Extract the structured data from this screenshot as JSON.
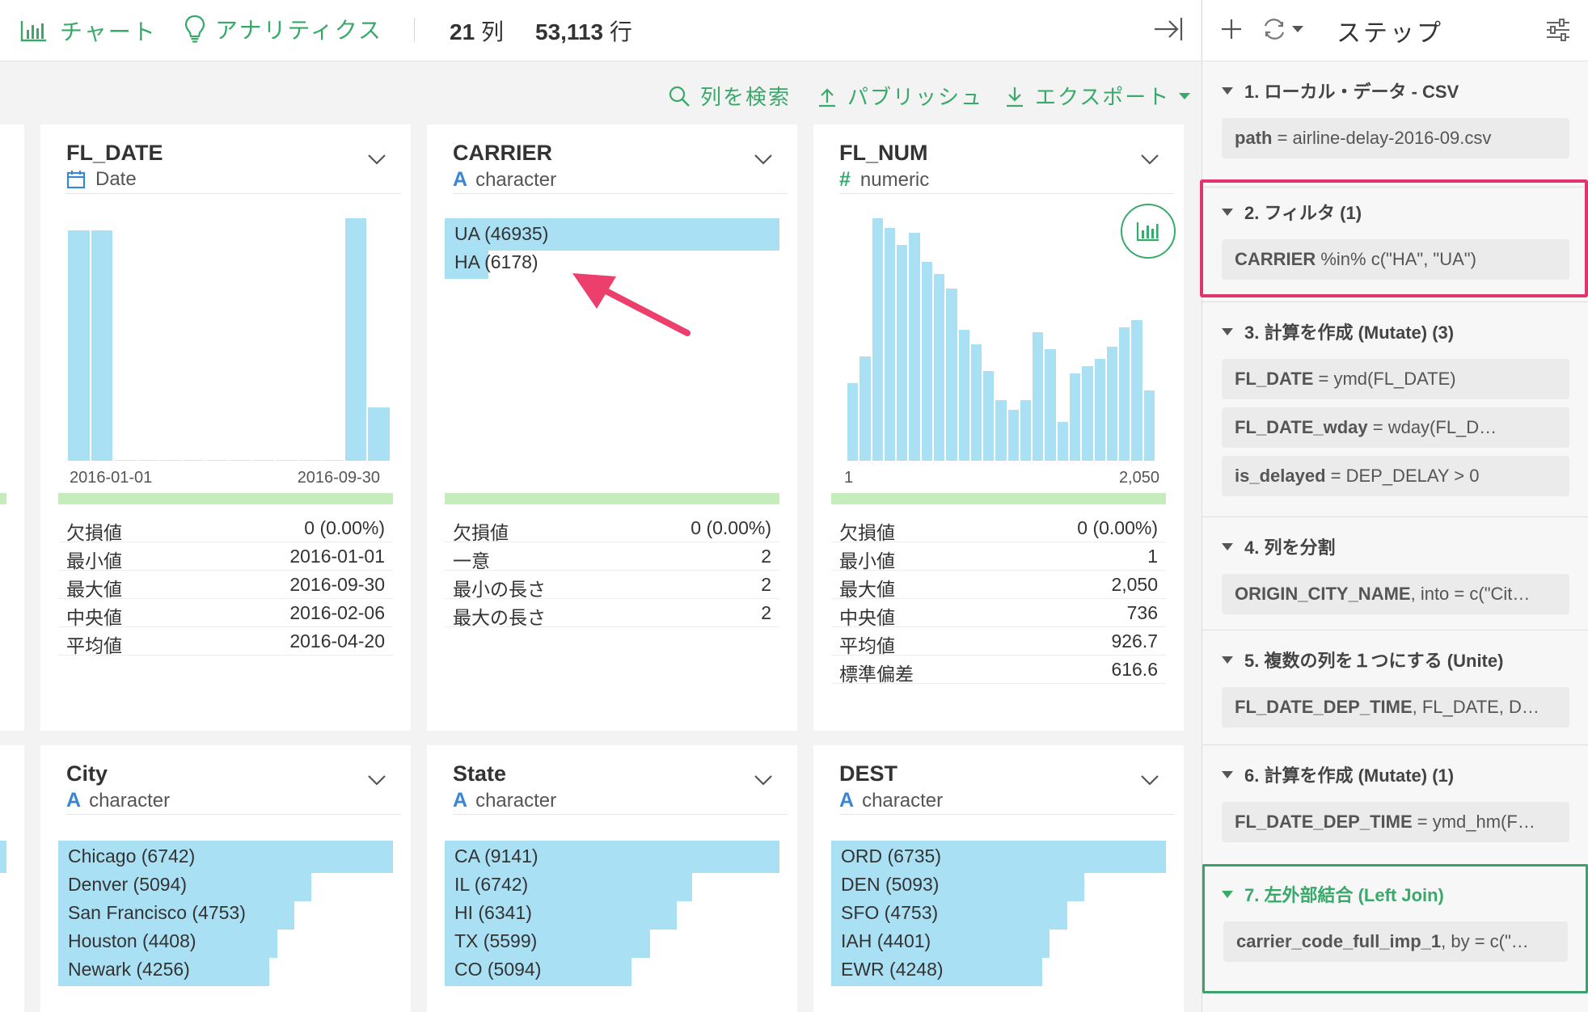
{
  "toolbar": {
    "chart_label": "チャート",
    "analytics_label": "アナリティクス",
    "cols_count": "21",
    "cols_unit": "列",
    "rows_count": "53,113",
    "rows_unit": "行"
  },
  "subbar": {
    "search_label": "列を検索",
    "publish_label": "パブリッシュ",
    "export_label": "エクスポート"
  },
  "cards": {
    "fl_date": {
      "name": "FL_DATE",
      "type": "Date",
      "axis_min": "2016-01-01",
      "axis_max": "2016-09-30",
      "hist": [
        0.95,
        0.95,
        0,
        0,
        0,
        0,
        0,
        0,
        0,
        0,
        0,
        0,
        1.0,
        0.22
      ],
      "stats": [
        {
          "k": "欠損値",
          "v": "0 (0.00%)"
        },
        {
          "k": "最小値",
          "v": "2016-01-01"
        },
        {
          "k": "最大値",
          "v": "2016-09-30"
        },
        {
          "k": "中央値",
          "v": "2016-02-06"
        },
        {
          "k": "平均値",
          "v": "2016-04-20"
        }
      ]
    },
    "carrier": {
      "name": "CARRIER",
      "type": "character",
      "cats": [
        {
          "label": "UA (46935)",
          "frac": 1.0
        },
        {
          "label": "HA (6178)",
          "frac": 0.13
        }
      ],
      "stats": [
        {
          "k": "欠損値",
          "v": "0 (0.00%)"
        },
        {
          "k": "一意",
          "v": "2"
        },
        {
          "k": "最小の長さ",
          "v": "2"
        },
        {
          "k": "最大の長さ",
          "v": "2"
        }
      ]
    },
    "fl_num": {
      "name": "FL_NUM",
      "type": "numeric",
      "axis_min": "1",
      "axis_max": "2,050",
      "hist": [
        0.32,
        0.43,
        1.0,
        0.96,
        0.89,
        0.94,
        0.82,
        0.77,
        0.71,
        0.54,
        0.48,
        0.37,
        0.25,
        0.21,
        0.25,
        0.53,
        0.46,
        0.16,
        0.36,
        0.39,
        0.42,
        0.47,
        0.55,
        0.58,
        0.29
      ],
      "stats": [
        {
          "k": "欠損値",
          "v": "0 (0.00%)"
        },
        {
          "k": "最小値",
          "v": "1"
        },
        {
          "k": "最大値",
          "v": "2,050"
        },
        {
          "k": "中央値",
          "v": "736"
        },
        {
          "k": "平均値",
          "v": "926.7"
        },
        {
          "k": "標準偏差",
          "v": "616.6"
        }
      ]
    },
    "city": {
      "name": "City",
      "type": "character",
      "cats": [
        {
          "label": "Chicago (6742)",
          "frac": 1.0
        },
        {
          "label": "Denver (5094)",
          "frac": 0.755
        },
        {
          "label": "San Francisco (4753)",
          "frac": 0.705
        },
        {
          "label": "Houston (4408)",
          "frac": 0.654
        },
        {
          "label": "Newark (4256)",
          "frac": 0.631
        }
      ]
    },
    "state": {
      "name": "State",
      "type": "character",
      "cats": [
        {
          "label": "CA (9141)",
          "frac": 1.0
        },
        {
          "label": "IL (6742)",
          "frac": 0.738
        },
        {
          "label": "HI (6341)",
          "frac": 0.694
        },
        {
          "label": "TX (5599)",
          "frac": 0.613
        },
        {
          "label": "CO (5094)",
          "frac": 0.557
        }
      ]
    },
    "dest": {
      "name": "DEST",
      "type": "character",
      "cats": [
        {
          "label": "ORD (6735)",
          "frac": 1.0
        },
        {
          "label": "DEN (5093)",
          "frac": 0.756
        },
        {
          "label": "SFO (4753)",
          "frac": 0.706
        },
        {
          "label": "IAH (4401)",
          "frac": 0.653
        },
        {
          "label": "EWR (4248)",
          "frac": 0.631
        }
      ]
    }
  },
  "steps_panel": {
    "title": "ステップ",
    "steps": [
      {
        "title": "1. ローカル・データ - CSV",
        "chips": [
          {
            "bold": "path",
            "rest": " = airline-delay-2016-09.csv"
          }
        ]
      },
      {
        "title": "2. フィルタ (1)",
        "chips": [
          {
            "bold": "CARRIER",
            "rest": " %in% c(\"HA\", \"UA\")"
          }
        ]
      },
      {
        "title": "3. 計算を作成 (Mutate) (3)",
        "chips": [
          {
            "bold": "FL_DATE",
            "rest": " = ymd(FL_DATE)"
          },
          {
            "bold": "FL_DATE_wday",
            "rest": " = wday(FL_D…"
          },
          {
            "bold": "is_delayed",
            "rest": " = DEP_DELAY > 0"
          }
        ]
      },
      {
        "title": "4. 列を分割",
        "chips": [
          {
            "bold": "ORIGIN_CITY_NAME",
            "rest": ", into = c(\"Cit…"
          }
        ]
      },
      {
        "title": "5. 複数の列を１つにする (Unite)",
        "chips": [
          {
            "bold": "FL_DATE_DEP_TIME",
            "rest": ", FL_DATE, D…"
          }
        ]
      },
      {
        "title": "6. 計算を作成 (Mutate) (1)",
        "chips": [
          {
            "bold": "FL_DATE_DEP_TIME",
            "rest": " = ymd_hm(F…"
          }
        ]
      },
      {
        "title": "7. 左外部結合 (Left Join)",
        "chips": [
          {
            "bold": "carrier_code_full_imp_1",
            "rest": ", by = c(\"…"
          }
        ]
      }
    ]
  },
  "colors": {
    "accent_green": "#38a96a",
    "bar_blue": "#a9e0f3",
    "highlight_red": "#e0356a",
    "arrow_pink": "#ec3f6b"
  }
}
